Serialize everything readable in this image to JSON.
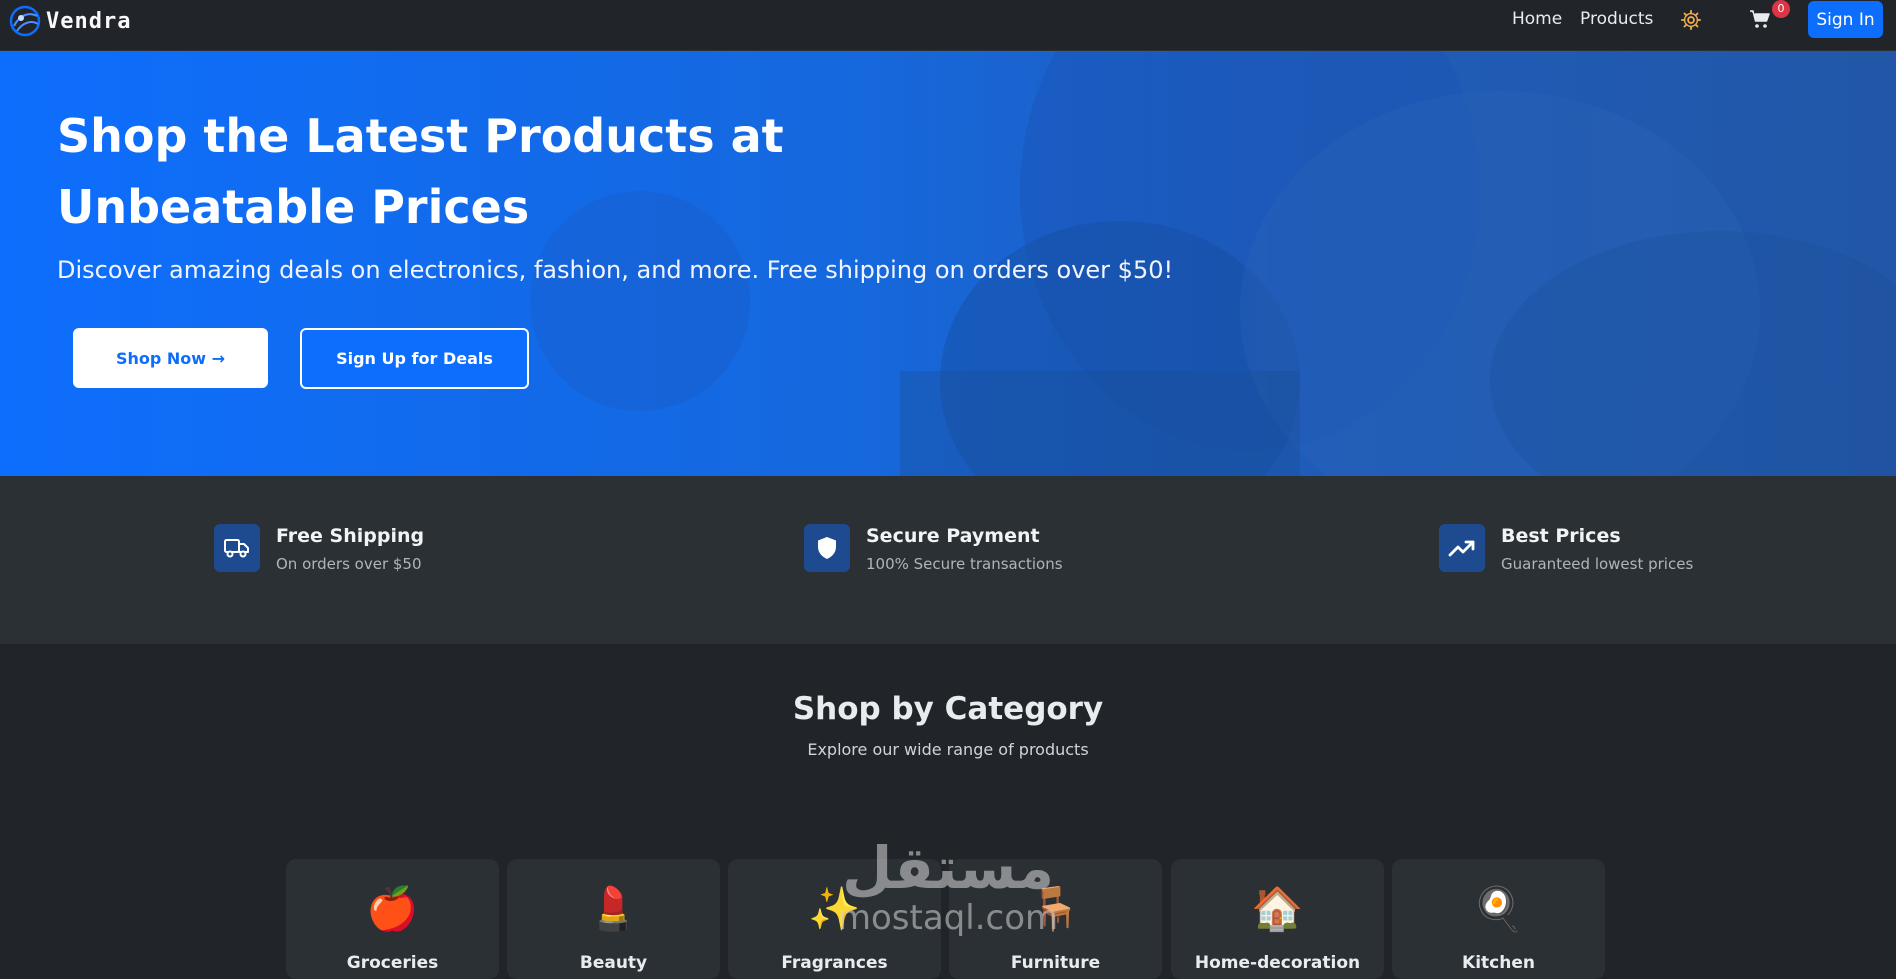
{
  "navbar": {
    "brand": "Vendra",
    "links": {
      "home": "Home",
      "products": "Products"
    },
    "cart_count": "0",
    "signin_label": "Sign In",
    "icons": {
      "logo": "globe-logo-icon",
      "settings": "gear-icon",
      "cart": "cart-icon"
    },
    "colors": {
      "accent": "#0d6efd",
      "badge": "#dc3545",
      "settings": "#f0ad4e"
    }
  },
  "hero": {
    "title": "Shop the Latest Products at Unbeatable Prices",
    "subtitle": "Discover amazing deals on electronics, fashion, and more. Free shipping on orders over $50!",
    "shop_now": "Shop Now →",
    "sign_up": "Sign Up for Deals"
  },
  "features": [
    {
      "title": "Free Shipping",
      "desc": "On orders over $50",
      "icon": "truck-icon"
    },
    {
      "title": "Secure Payment",
      "desc": "100% Secure transactions",
      "icon": "shield-icon"
    },
    {
      "title": "Best Prices",
      "desc": "Guaranteed lowest prices",
      "icon": "trending-up-icon"
    }
  ],
  "categories": {
    "heading": "Shop by Category",
    "subheading": "Explore our wide range of products",
    "items": [
      {
        "emoji": "🍎",
        "label": "Groceries"
      },
      {
        "emoji": "💄",
        "label": "Beauty"
      },
      {
        "emoji": "✨",
        "label": "Fragrances"
      },
      {
        "emoji": "🪑",
        "label": "Furniture"
      },
      {
        "emoji": "🏠",
        "label": "Home-decoration"
      },
      {
        "emoji": "🍳",
        "label": "Kitchen"
      }
    ]
  },
  "watermark": {
    "arabic": "مستقل",
    "latin": "mostaql.com"
  }
}
